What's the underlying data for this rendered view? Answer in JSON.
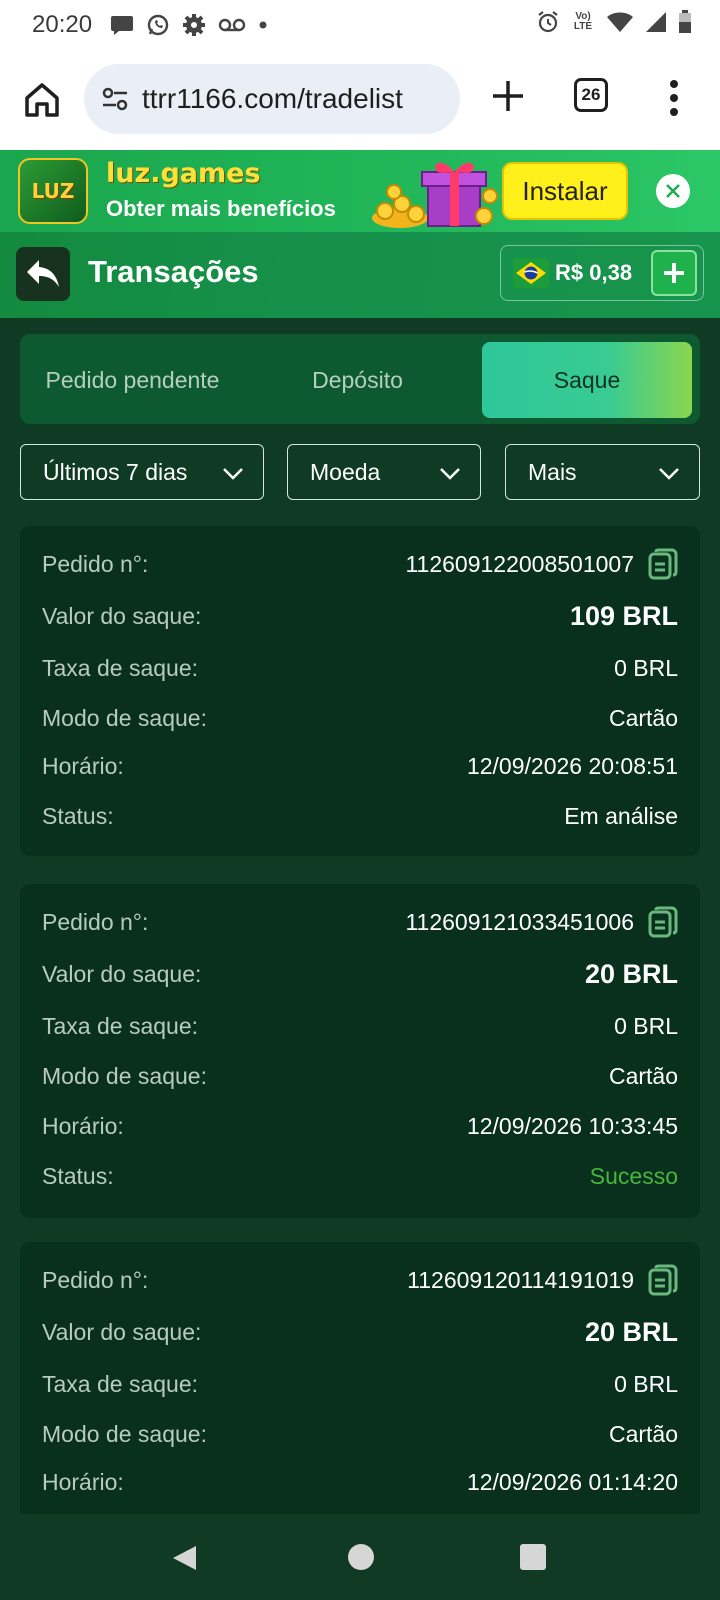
{
  "status_bar": {
    "time": "20:20",
    "left_icons": [
      "chat-bubble-icon",
      "whatsapp-icon",
      "settings-gear-icon",
      "voicemail-icon",
      "dot-icon"
    ],
    "right_icons": [
      "alarm-icon",
      "volte-icon",
      "wifi-icon",
      "signal-icon",
      "battery-icon"
    ],
    "network_label": "Vo) LTE"
  },
  "browser": {
    "url": "ttrr1166.com/tradelist",
    "tab_count": "26"
  },
  "banner": {
    "logo_text": "LUZ",
    "brand": "luz.games",
    "subtitle": "Obter mais benefícios",
    "install_label": "Instalar"
  },
  "header": {
    "title": "Transações",
    "balance": "R$ 0,38"
  },
  "tabs": [
    {
      "label": "Pedido pendente",
      "active": false
    },
    {
      "label": "Depósito",
      "active": false
    },
    {
      "label": "Saque",
      "active": true
    }
  ],
  "filters": [
    {
      "label": "Últimos 7 dias"
    },
    {
      "label": "Moeda"
    },
    {
      "label": "Mais"
    }
  ],
  "labels": {
    "order_no": "Pedido n°:",
    "amount": "Valor do saque:",
    "fee": "Taxa de saque:",
    "mode": "Modo de saque:",
    "time": "Horário:",
    "status": "Status:"
  },
  "transactions": [
    {
      "order_no": "112609122008501007",
      "amount": "109 BRL",
      "fee": "0 BRL",
      "mode": "Cartão",
      "time": "12/09/2026 20:08:51",
      "status": "Em análise",
      "status_color": "#ffffff"
    },
    {
      "order_no": "112609121033451006",
      "amount": "20 BRL",
      "fee": "0 BRL",
      "mode": "Cartão",
      "time": "12/09/2026 10:33:45",
      "status": "Sucesso",
      "status_color": "#46b63c"
    },
    {
      "order_no": "112609120114191019",
      "amount": "20 BRL",
      "fee": "0 BRL",
      "mode": "Cartão",
      "time": "12/09/2026 01:14:20",
      "status": "",
      "status_color": "#ffffff"
    }
  ],
  "colors": {
    "accent_green": "#46b63c",
    "tab_active_start": "#2ec79a",
    "tab_active_end": "#8ad64f",
    "header_green": "#16904a"
  }
}
